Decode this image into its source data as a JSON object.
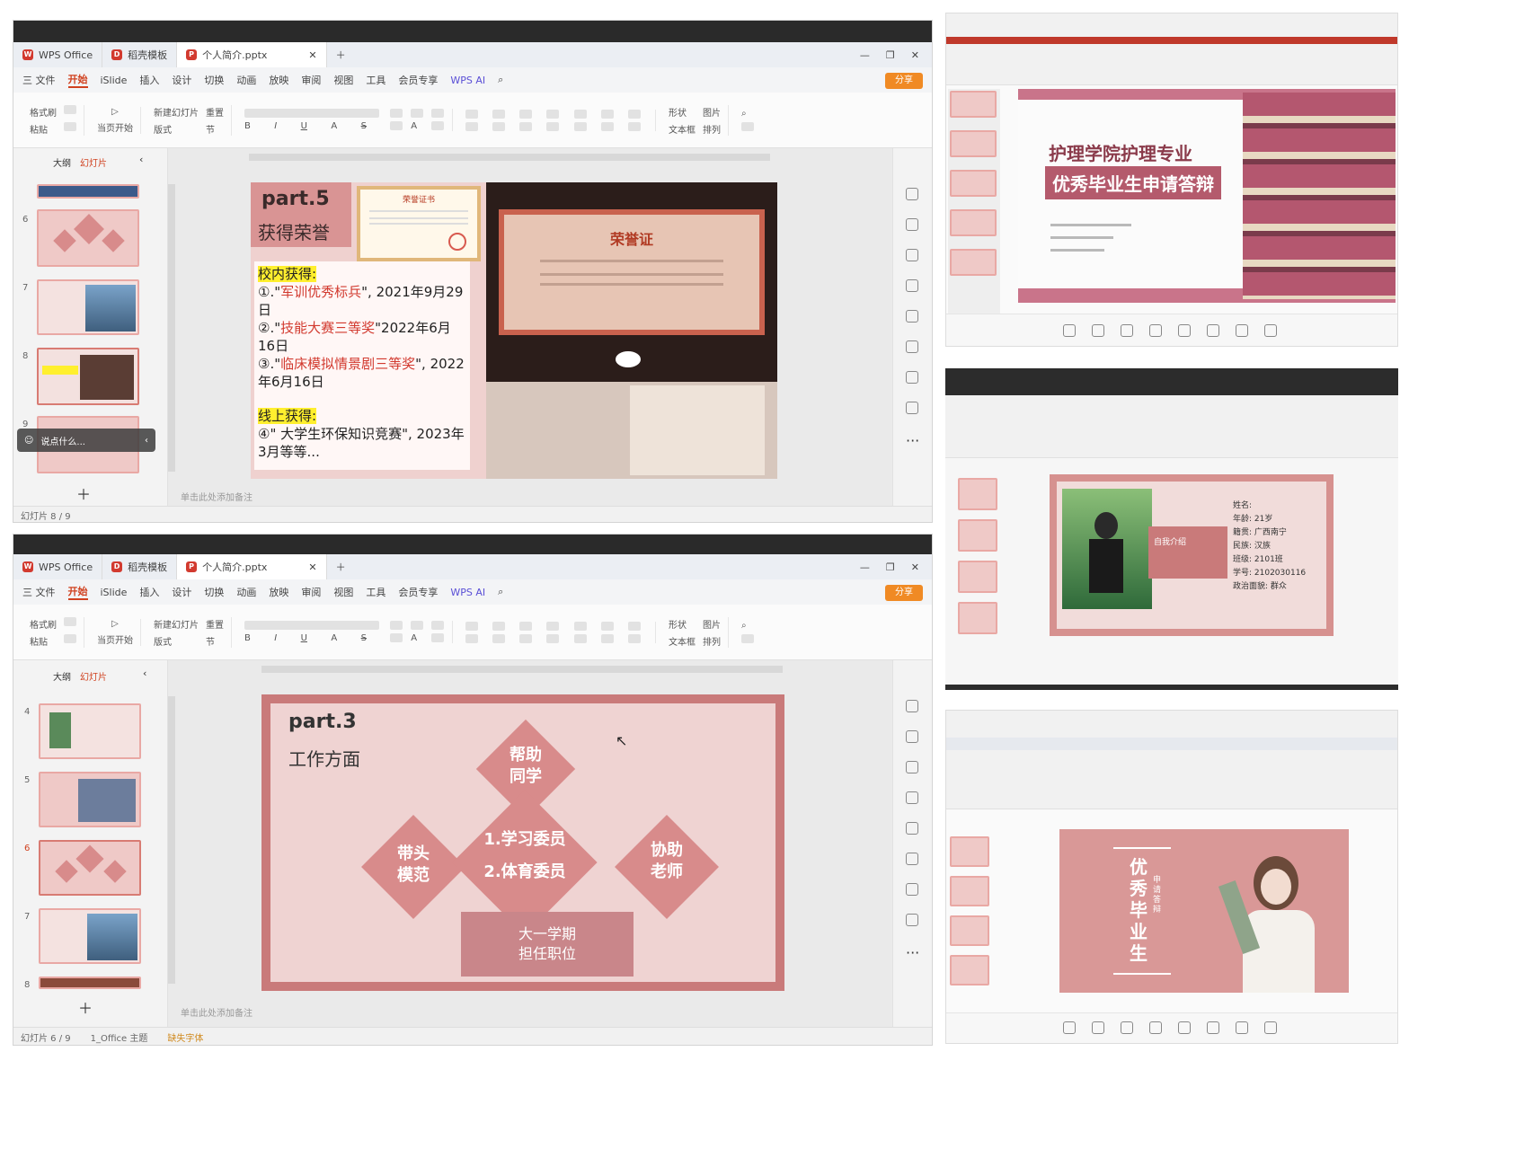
{
  "top": {
    "tabs": [
      "WPS Office",
      "稻壳模板",
      "个人简介.pptx"
    ],
    "menu": [
      "三 文件",
      "开始",
      "iSlide",
      "插入",
      "设计",
      "切换",
      "动画",
      "放映",
      "审阅",
      "视图",
      "工具",
      "会员专享",
      "WPS AI"
    ],
    "share_label": "分享",
    "ribbon_labels": [
      "格式刷",
      "粘贴",
      "当页开始",
      "新建幻灯片",
      "版式",
      "重置",
      "节",
      "形状",
      "图片",
      "文本框",
      "排列"
    ],
    "pane_tabs": [
      "大纲",
      "幻灯片"
    ],
    "thumb_numbers": [
      "6",
      "7",
      "8",
      "9"
    ],
    "comment_placeholder": "说点什么...",
    "notes_hint": "单击此处添加备注",
    "status_left": "幻灯片 8 / 9",
    "slide": {
      "part_title": "part.5",
      "subtitle": "获得荣誉",
      "school_heading": "校内获得:",
      "item1_prefix": "①.\"",
      "item1_red": "军训优秀标兵",
      "item1_suffix": "\", 2021年9月29日",
      "item2_prefix": "②.\"",
      "item2_red": "技能大赛三等奖",
      "item2_suffix": "\"2022年6月16日",
      "item3_prefix": "③.\"",
      "item3_red": "临床模拟情景剧三等奖",
      "item3_suffix": "\", 2022年6月16日",
      "online_heading": "线上获得:",
      "item4": "④\" 大学生环保知识竞赛\", 2023年3月等等...",
      "cert_title": "荣誉证书",
      "photo_cert_title": "荣誉证"
    }
  },
  "bottom": {
    "tabs": [
      "WPS Office",
      "稻壳模板",
      "个人简介.pptx"
    ],
    "menu": [
      "三 文件",
      "开始",
      "iSlide",
      "插入",
      "设计",
      "切换",
      "动画",
      "放映",
      "审阅",
      "视图",
      "工具",
      "会员专享",
      "WPS AI"
    ],
    "share_label": "分享",
    "ribbon_labels": [
      "格式刷",
      "粘贴",
      "当页开始",
      "新建幻灯片",
      "版式",
      "重置",
      "节",
      "形状",
      "图片",
      "文本框",
      "排列"
    ],
    "pane_tabs": [
      "大纲",
      "幻灯片"
    ],
    "thumb_numbers": [
      "4",
      "5",
      "6",
      "7",
      "8"
    ],
    "notes_hint": "单击此处添加备注",
    "status_left": "幻灯片 6 / 9",
    "status_theme": "1_Office 主题",
    "status_font": "缺失字体",
    "slide": {
      "part_title": "part.3",
      "subtitle": "工作方面",
      "top_diamond": "帮助\n同学",
      "left_diamond": "带头\n模范",
      "center_line1": "1.学习委员",
      "center_line2": "2.体育委员",
      "right_diamond": "协助\n老师",
      "box": "大一学期\n担任职位"
    }
  },
  "right1": {
    "title_line1": "护理学院护理专业",
    "title_line2": "优秀毕业生申请答辩"
  },
  "right2": {
    "info_lines": [
      "姓名:",
      "年龄: 21岁",
      "籍贯: 广西南宁",
      "民族: 汉族",
      "班级: 2101班",
      "学号: 2102030116",
      "政治面貌: 群众"
    ],
    "side_label": "自我介绍"
  },
  "right3": {
    "title_chars": [
      "优",
      "秀",
      "毕",
      "业",
      "生"
    ],
    "side_text": "申请答辩"
  },
  "colors": {
    "slide_pink": "#e8b5b3",
    "slide_dark": "#c97a7a",
    "accent_red": "#d23a2f",
    "diamond": "#d88b8b",
    "box": "#c9868a",
    "highlight": "#ffef2e"
  }
}
